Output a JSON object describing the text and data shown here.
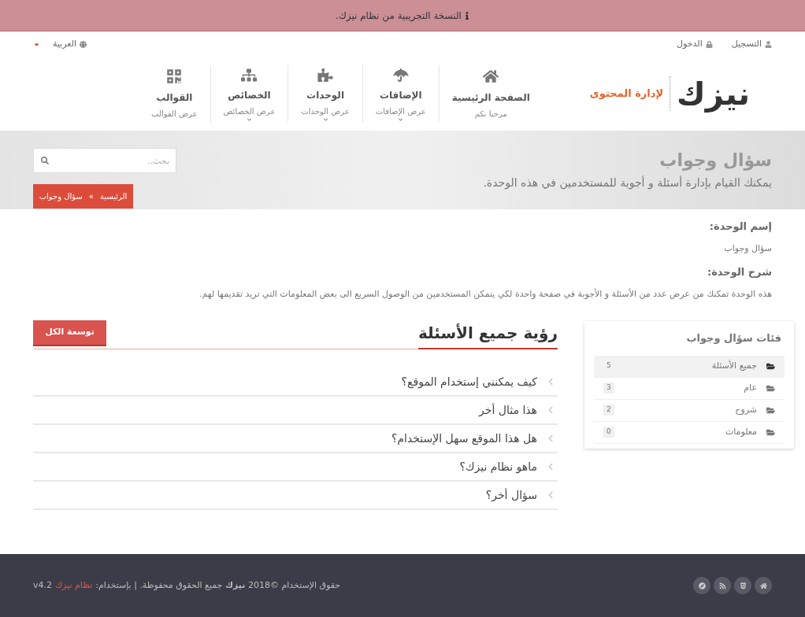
{
  "notice": {
    "text": "النسخة التجريبية من نظام نيزك."
  },
  "top_bar": {
    "links": [
      {
        "kind": "register",
        "label": "التسجيل"
      },
      {
        "kind": "login",
        "label": "الدخول"
      }
    ],
    "language": "العربية"
  },
  "logo": {
    "name": "نيزك",
    "tagline": "لإدارة المحتوى"
  },
  "nav": [
    {
      "kind": "home",
      "title": "الصفحة الرئيسية",
      "subtitle": "مرحبا بكم",
      "dropdown": false
    },
    {
      "kind": "plugins",
      "title": "الإضافات",
      "subtitle": "عرض الإضافات",
      "dropdown": true
    },
    {
      "kind": "modules",
      "title": "الوحدات",
      "subtitle": "عرض الوحدات",
      "dropdown": true
    },
    {
      "kind": "properties",
      "title": "الخصائص",
      "subtitle": "عرض الخصائص",
      "dropdown": true
    },
    {
      "kind": "templates",
      "title": "القوالب",
      "subtitle": "عرض القوالب",
      "dropdown": false
    }
  ],
  "hero": {
    "title": "سؤال وجواب",
    "subtitle": "يمكنك القيام بإدارة أسئلة و أجوبة للمستخدمين في هذه الوحدة.",
    "search": {
      "placeholder": "بحث.."
    },
    "breadcrumb": [
      "الرئيسية",
      "سؤال وجواب"
    ],
    "breadcrumb_separator": "»"
  },
  "module_info": [
    {
      "label": "إسم الوحدة:",
      "value": "سؤال وجواب"
    },
    {
      "label": "شرح الوحدة:",
      "value": "هذه الوحدة تمكنك من عرض عدد من الأسئلة و الأجوبة في صفحة واحدة لكي يتمكن المستخدمين من الوصول السريع الى بعض المعلومات التي تريد تقديمها لهم."
    }
  ],
  "categories": {
    "title": "فئات سؤال وجواب",
    "items": [
      {
        "label": "جميع الأسئلة",
        "count": "5",
        "selected": true
      },
      {
        "label": "عام",
        "count": "3",
        "selected": false
      },
      {
        "label": "شروح",
        "count": "2",
        "selected": false
      },
      {
        "label": "معلومات",
        "count": "0",
        "selected": false
      }
    ]
  },
  "questions": {
    "title": "رؤية جميع الأسئلة",
    "expand_button": "توسعة الكل",
    "items": [
      {
        "text": "كيف يمكنني إستخدام الموقع؟",
        "expanded": false
      },
      {
        "text": "هذا مثال أخر",
        "expanded": false
      },
      {
        "text": "هل هذا الموقع سهل الإستخدام؟",
        "expanded": false
      },
      {
        "text": "ماهو نظام نيزك؟",
        "expanded": false
      },
      {
        "text": "سؤال أخر؟",
        "expanded": false
      }
    ]
  },
  "footer": {
    "copyright": "حقوق الإستخدام ©2018 **نيزك** جميع الحقوق محفوظة. | بإستخدام:",
    "link": "نظام نيزك",
    "version": "v4.2",
    "icons": [
      {
        "kind": "home"
      },
      {
        "kind": "html5"
      },
      {
        "kind": "rss"
      },
      {
        "kind": "compass"
      }
    ]
  }
}
